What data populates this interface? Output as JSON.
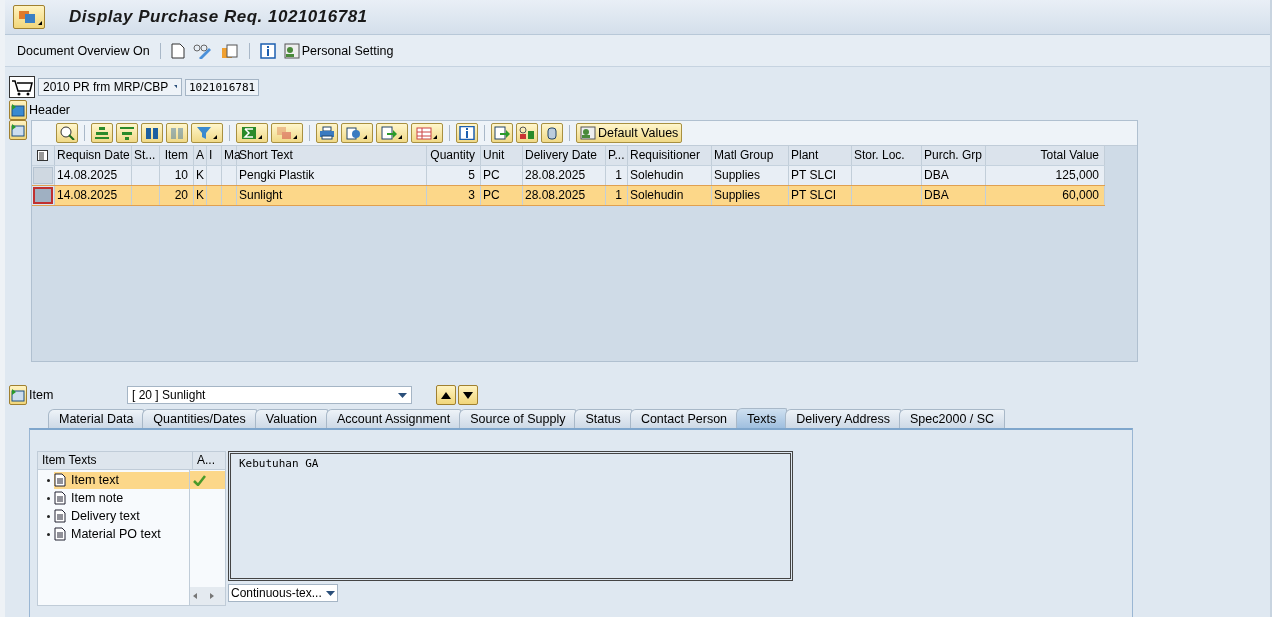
{
  "window": {
    "title": "Display Purchase Req. 1021016781"
  },
  "toolbar": {
    "items": [
      {
        "kind": "text",
        "label": "Document Overview On"
      },
      {
        "kind": "icon",
        "label": "Personal Setting"
      }
    ]
  },
  "document": {
    "type": "2010 PR frm MRP/CBP",
    "number": "1021016781"
  },
  "header_section": {
    "label": "Header",
    "expanded": false
  },
  "grid_toolbar": {
    "default_values": "Default Values"
  },
  "table": {
    "columns": [
      "Requisn Date",
      "St...",
      "Item",
      "A",
      "I",
      "Ma",
      "Short Text",
      "Quantity",
      "Unit",
      "Delivery Date",
      "P...",
      "Requisitioner",
      "Matl Group",
      "Plant",
      "Stor. Loc.",
      "Purch. Grp",
      "Total Value"
    ],
    "rows": [
      {
        "selected": false,
        "cells": [
          "14.08.2025",
          "",
          "10",
          "K",
          "",
          "",
          "Pengki Plastik",
          "5",
          "PC",
          "28.08.2025",
          "1",
          "Solehudin",
          "Supplies",
          "PT SLCI",
          "",
          "DBA",
          "125,000"
        ]
      },
      {
        "selected": true,
        "cells": [
          "14.08.2025",
          "",
          "20",
          "K",
          "",
          "",
          "Sunlight",
          "3",
          "PC",
          "28.08.2025",
          "1",
          "Solehudin",
          "Supplies",
          "PT SLCI",
          "",
          "DBA",
          "60,000"
        ]
      }
    ]
  },
  "item_section": {
    "label": "Item",
    "value": "[ 20 ] Sunlight"
  },
  "tabs": [
    {
      "label": "Material Data",
      "selected": false
    },
    {
      "label": "Quantities/Dates",
      "selected": false
    },
    {
      "label": "Valuation",
      "selected": false
    },
    {
      "label": "Account Assignment",
      "selected": false
    },
    {
      "label": "Source of Supply",
      "selected": false
    },
    {
      "label": "Status",
      "selected": false
    },
    {
      "label": "Contact Person",
      "selected": false
    },
    {
      "label": "Texts",
      "selected": true
    },
    {
      "label": "Delivery Address",
      "selected": false
    },
    {
      "label": "Spec2000 / SC",
      "selected": false
    }
  ],
  "texts": {
    "tree_header": "Item Texts",
    "assigned_header": "A...",
    "items": [
      {
        "label": "Item text",
        "selected": true,
        "assigned": true
      },
      {
        "label": "Item note",
        "selected": false,
        "assigned": false
      },
      {
        "label": "Delivery text",
        "selected": false,
        "assigned": false
      },
      {
        "label": "Material PO text",
        "selected": false,
        "assigned": false
      }
    ],
    "editor_text": "Kebutuhan GA",
    "format": "Continuous-tex..."
  }
}
